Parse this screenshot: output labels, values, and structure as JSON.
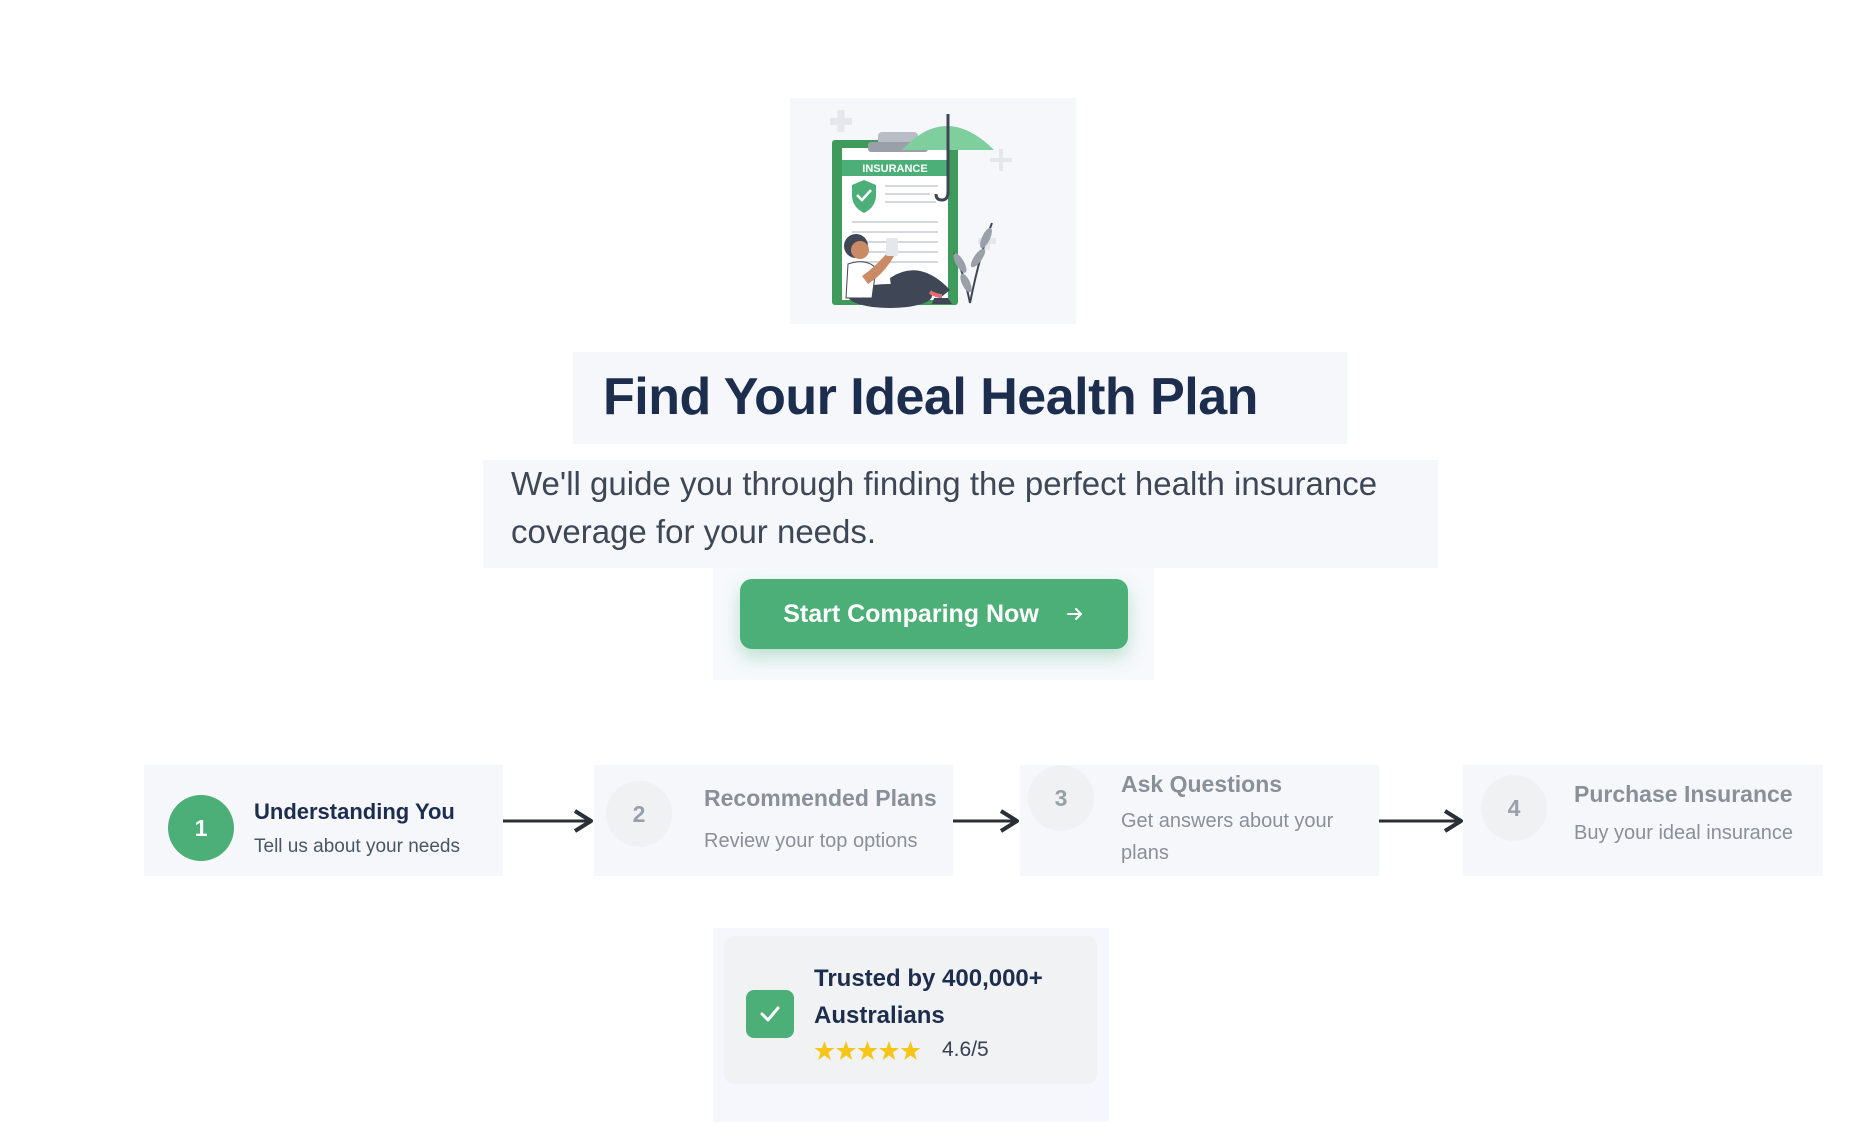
{
  "hero": {
    "illustration_label": "INSURANCE",
    "title": "Find Your Ideal Health Plan",
    "subtitle": "We'll guide you through finding the perfect health insurance coverage for your needs.",
    "cta_label": "Start Comparing Now"
  },
  "steps": [
    {
      "number": "1",
      "title": "Understanding You",
      "description": "Tell us about your needs",
      "active": true
    },
    {
      "number": "2",
      "title": "Recommended Plans",
      "description": "Review your top options",
      "active": false
    },
    {
      "number": "3",
      "title": "Ask Questions",
      "description": "Get answers about your plans",
      "active": false
    },
    {
      "number": "4",
      "title": "Purchase Insurance",
      "description": "Buy your ideal insurance",
      "active": false
    }
  ],
  "trust": {
    "title": "Trusted by 400,000+ Australians",
    "stars": 5,
    "rating": "4.6/5"
  },
  "colors": {
    "accent": "#4caf77",
    "heading": "#1d2d4e",
    "muted": "#8a8f98",
    "star": "#f5c518"
  },
  "icons": {
    "cta": "arrow-right-icon",
    "trust": "check-icon",
    "rating": "star-icon",
    "connector": "arrow-right-icon"
  }
}
